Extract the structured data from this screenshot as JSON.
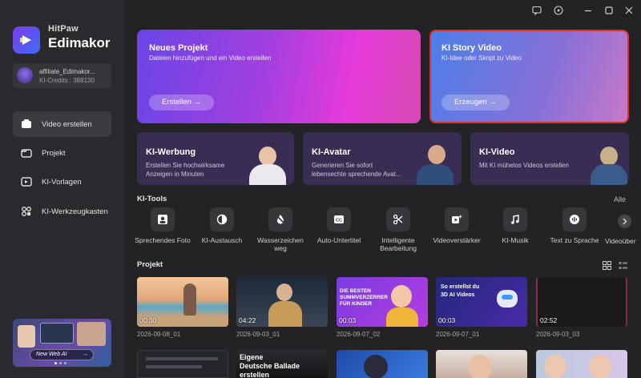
{
  "brand": {
    "top": "HitPaw",
    "main": "Edimakor"
  },
  "account": {
    "name": "affiliate_Edimakor...",
    "credits": "KI-Credits : 388130"
  },
  "nav": [
    {
      "label": "Video erstellen",
      "icon": "video-create-icon",
      "active": true
    },
    {
      "label": "Projekt",
      "icon": "folder-icon",
      "active": false
    },
    {
      "label": "KI-Vorlagen",
      "icon": "template-icon",
      "active": false
    },
    {
      "label": "KI-Werkzeugkasten",
      "icon": "toolbox-icon",
      "active": false
    }
  ],
  "promo": {
    "pill": "New Web AI",
    "arrow": "→"
  },
  "hero": [
    {
      "title": "Neues Projekt",
      "subtitle": "Dateien hinzufügen und ein Video erstellen",
      "button": "Erstellen →"
    },
    {
      "title": "KI Story Video",
      "subtitle": "KI-Idee oder Skript zu Video",
      "button": "Erzeugen →"
    }
  ],
  "cards": [
    {
      "title": "KI-Werbung",
      "subtitle": "Erstellen Sie hochwirksame Anzeigen in Minuten"
    },
    {
      "title": "KI-Avatar",
      "subtitle": "Generieren Sie sofort lebensechte sprechende Avat..."
    },
    {
      "title": "KI-Video",
      "subtitle": "Mit KI mühelos Videos erstellen"
    }
  ],
  "tools_title": "KI-Tools",
  "tools_all": "Alle",
  "tools": [
    {
      "label": "Sprechendes Foto",
      "icon": "talking-photo-icon"
    },
    {
      "label": "KI-Austausch",
      "icon": "face-swap-icon"
    },
    {
      "label": "Wasserzeichen weg",
      "icon": "watermark-remove-icon"
    },
    {
      "label": "Auto-Untertitel",
      "icon": "subtitle-icon"
    },
    {
      "label": "Intelligente Bearbeitung",
      "icon": "smart-edit-icon"
    },
    {
      "label": "Videoverstärker",
      "icon": "enhancer-icon"
    },
    {
      "label": "KI-Musik",
      "icon": "music-icon"
    },
    {
      "label": "Text zu Sprache",
      "icon": "tts-icon"
    },
    {
      "label": "Videoüber",
      "icon": "video-translate-icon"
    }
  ],
  "projects_title": "Projekt",
  "projects": [
    {
      "duration": "00:30",
      "date": "2026-09-08_01"
    },
    {
      "duration": "04:22",
      "date": "2026-09-03_01"
    },
    {
      "duration": "00:03",
      "date": "2026-09-07_02",
      "banner": "DIE BESTEN\nSUMMVERZERRER\nFÜR KINDER"
    },
    {
      "duration": "00:03",
      "date": "2026-09-07_01",
      "banner": "So erstellst du\n3D AI Videos"
    },
    {
      "duration": "02:52",
      "date": "2026-09-03_03"
    }
  ],
  "projects_row2": [
    {
      "banner": ""
    },
    {
      "banner": "Eigene\nDeutsche Ballade\nerstellen"
    },
    {
      "banner": ""
    },
    {
      "banner": ""
    },
    {
      "banner": ""
    }
  ]
}
